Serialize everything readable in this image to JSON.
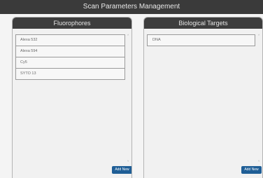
{
  "window": {
    "title": "Scan Parameters Management"
  },
  "fluorophores": {
    "title": "Fluorophores",
    "items": [
      "Alexa 532",
      "Alexa 594",
      "Cy5",
      "SYTO 13"
    ],
    "add_label": "Add New"
  },
  "targets": {
    "title": "Biological Targets",
    "items": [
      "DNA"
    ],
    "add_label": "Add New"
  },
  "icons": {
    "scroll_up": "chevron-up-icon",
    "scroll_down": "chevron-down-icon"
  },
  "colors": {
    "titlebar": "#3a3a3a",
    "panel_header": "#3d3d3d",
    "button": "#1f5e96",
    "background": "#f4f4f4"
  }
}
